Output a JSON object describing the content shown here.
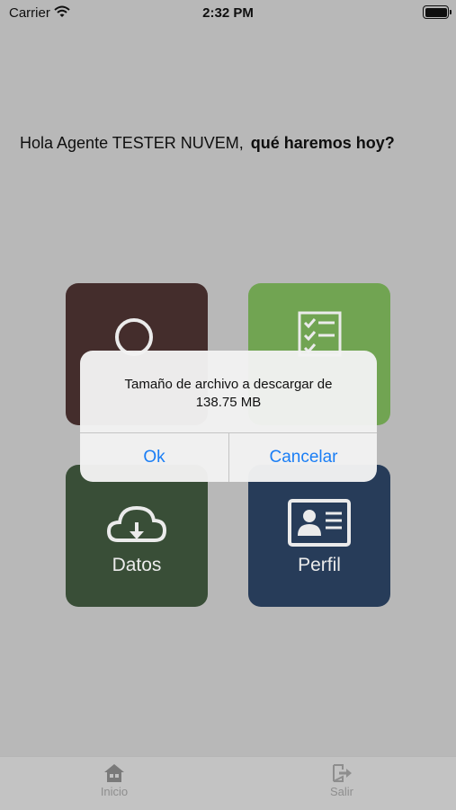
{
  "status_bar": {
    "carrier": "Carrier",
    "time": "2:32 PM"
  },
  "greeting": {
    "text": "Hola Agente TESTER NUVEM,",
    "question": "qué haremos hoy?"
  },
  "tiles": [
    {
      "label": "",
      "icon": "user-icon",
      "color": "#4a3130"
    },
    {
      "label": "",
      "icon": "checklist-icon",
      "color": "#7bb25a"
    },
    {
      "label": "Datos",
      "icon": "cloud-download-icon",
      "color": "#3e553c"
    },
    {
      "label": "Perfil",
      "icon": "id-card-icon",
      "color": "#2b4261"
    }
  ],
  "alert": {
    "message_line1": "Tamaño de archivo a descargar de",
    "message_line2": "138.75 MB",
    "ok_label": "Ok",
    "cancel_label": "Cancelar",
    "button_color": "#1a7ef5"
  },
  "tab_bar": {
    "items": [
      {
        "label": "Inicio",
        "icon": "home-icon"
      },
      {
        "label": "Salir",
        "icon": "logout-icon"
      }
    ]
  }
}
